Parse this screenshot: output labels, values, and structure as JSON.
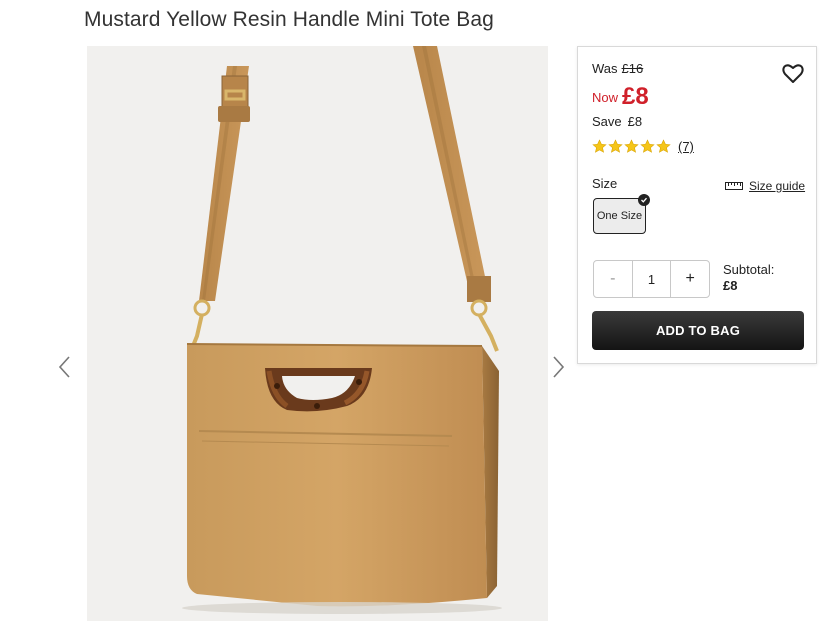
{
  "product": {
    "title": "Mustard Yellow Resin Handle Mini Tote Bag"
  },
  "gallery": {
    "image_icon": "mustard-tote-bag-photo",
    "prev_icon": "chevron-left-icon",
    "next_icon": "chevron-right-icon"
  },
  "pricing": {
    "was_label": "Was",
    "was_price": "£16",
    "now_label": "Now",
    "now_price": "£8",
    "save_label": "Save",
    "save_amount": "£8",
    "accent_color": "#d0202a"
  },
  "rating": {
    "stars": 5,
    "max_stars": 5,
    "review_count": "(7)",
    "star_color": "#f5c518"
  },
  "size": {
    "label": "Size",
    "guide_label": "Size guide",
    "selected": "One Size"
  },
  "quantity": {
    "minus": "-",
    "value": "1",
    "plus": "+"
  },
  "subtotal": {
    "label": "Subtotal:",
    "value": "£8"
  },
  "actions": {
    "add_to_bag": "ADD TO BAG",
    "wishlist_icon": "heart-icon"
  }
}
